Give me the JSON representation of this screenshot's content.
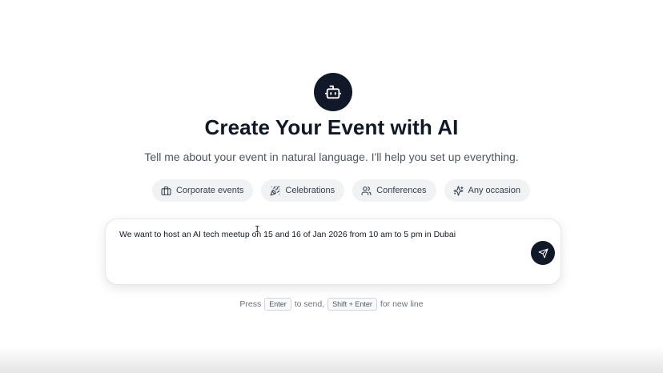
{
  "hero": {
    "icon": "bot-icon",
    "title": "Create Your Event with AI",
    "subtitle": "Tell me about your event in natural language. I'll help you set up everything."
  },
  "chips": [
    {
      "label": "Corporate events",
      "icon": "briefcase-icon"
    },
    {
      "label": "Celebrations",
      "icon": "party-popper-icon"
    },
    {
      "label": "Conferences",
      "icon": "users-icon"
    },
    {
      "label": "Any occasion",
      "icon": "sparkles-icon"
    }
  ],
  "prompt": {
    "value": "We want to host an AI tech meetup on 15 and 16 of Jan 2026 from 10 am to 5 pm in Dubai",
    "send_icon": "send-icon"
  },
  "hint": {
    "press": "Press",
    "enter_key": "Enter",
    "to_send": "to send,",
    "shift_enter_key": "Shift + Enter",
    "for_new_line": "for new line"
  },
  "colors": {
    "primary": "#111827",
    "chip_bg": "#f1f2f4",
    "muted_text": "#6b7280"
  }
}
